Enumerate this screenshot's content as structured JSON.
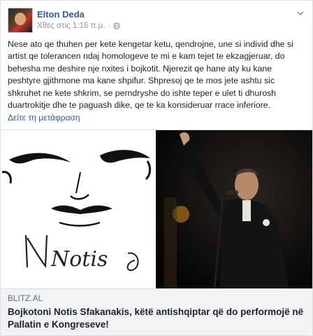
{
  "post": {
    "author": "Elton Deda",
    "timestamp": "Χθες στις 1:16 π.μ.",
    "separator": "·",
    "text": "Nese ato qe thuhen per kete kengetar ketu, qendrojne, une si individ dhe si artist qe tolerancen ndaj homologeve te mi e kam tejet te ekzagjeruar, do behesha me deshire nje nxites i bojkotit. Njerezit qe hane aty ku kane peshtyre gjithmone ma kane shpifur. Shpresoj qe te mos jete ashtu sic shkruhet ne kete shkrim, se perndryshe do ishte teper e ulet ti dhurosh duartrokitje dhe te paguash dike, qe te ka konsideruar rrace inferiore.",
    "translate_label": "Δείτε τη μετάφραση"
  },
  "images": {
    "left_signature": "Notis",
    "left_icon": "face-sketch-signature-image",
    "right_icon": "singer-on-stage-photo"
  },
  "link": {
    "domain": "BLITZ.AL",
    "title": "Bojkotoni Notis Sfakanakis, këtë antishqiptar që do performojë në Pallatin e Kongreseve!"
  },
  "icons": {
    "privacy": "globe-icon",
    "menu": "chevron-down-icon"
  },
  "colors": {
    "author": "#365899",
    "meta": "#90949c",
    "link_bg": "#f2f3f5"
  }
}
